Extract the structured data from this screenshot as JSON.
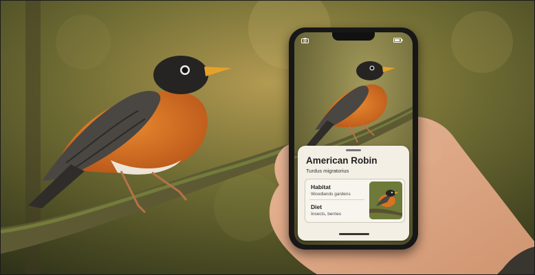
{
  "card": {
    "common_name": "American Robin",
    "scientific_name": "Turdus migratorius",
    "habitat_label": "Habitat",
    "habitat_value": "Woodlands gardens",
    "diet_label": "Diet",
    "diet_value": "Insects, berries"
  },
  "colors": {
    "robin_breast": "#d9731f",
    "robin_head": "#262422",
    "card_background": "#f3efe5",
    "phone_frame": "#171717",
    "forest_background": "#6b6a32"
  },
  "icons": [
    "camera-icon",
    "battery-icon"
  ]
}
